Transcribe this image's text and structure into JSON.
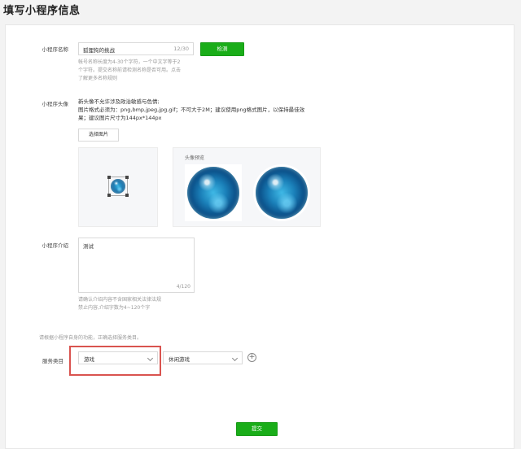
{
  "page": {
    "title": "填写小程序信息"
  },
  "name_field": {
    "label": "小程序名称",
    "value": "狐狸狗的挑战",
    "counter": "12/30",
    "check_button": "检测",
    "hint_lines": [
      "帐号名称长度为4-30个字符，一个中文字等于2",
      "个字符。提交名称前请检测名称是否可用。点击",
      "了解更多名称规则"
    ]
  },
  "avatar": {
    "label": "小程序头像",
    "req_lines": [
      "新头像不允许涉及政治敏感与色情;",
      "图片格式必须为：png,bmp,jpeg,jpg,gif；不可大于2M；建议使用png格式图片，以保持最佳效",
      "果；建议图片尺寸为144px*144px"
    ],
    "select_button": "选择图片",
    "preview_label": "头像预览"
  },
  "intro": {
    "label": "小程序介绍",
    "value": "测试",
    "counter": "4/120",
    "hint_lines": [
      "请确认介绍内容不含国家相关法律法规",
      "禁止内容,介绍字数为4~120个字"
    ]
  },
  "category": {
    "note": "请根据小程序自身的功能，正确选择服务类目。",
    "label": "服务类目",
    "primary": "游戏",
    "secondary": "休闲游戏",
    "add_symbol": "+"
  },
  "submit": {
    "label": "提交"
  },
  "colors": {
    "accent": "#1aad19",
    "highlight_box": "#d9534f"
  }
}
